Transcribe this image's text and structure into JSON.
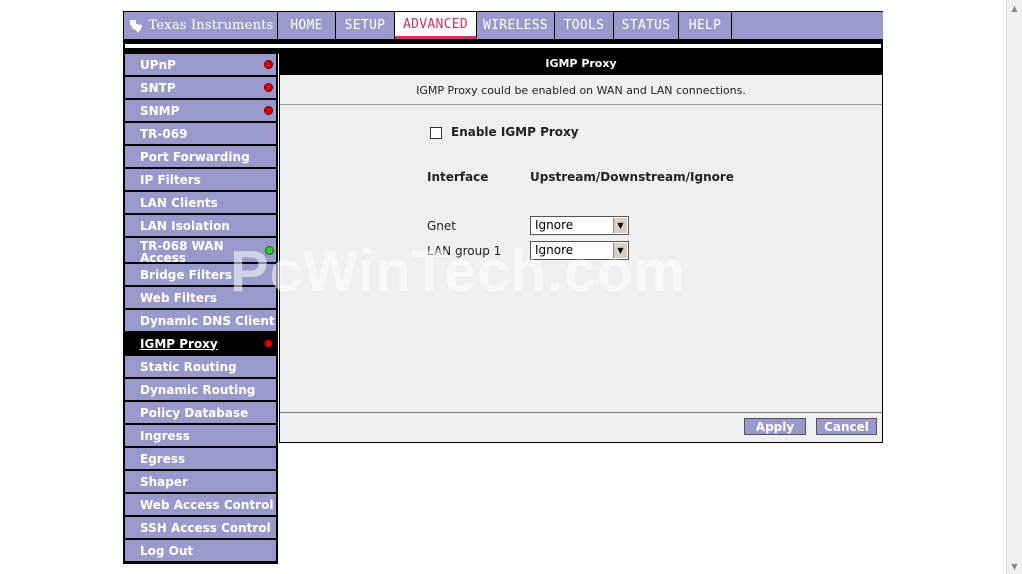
{
  "brand": {
    "name": "Texas Instruments"
  },
  "nav": {
    "tabs": [
      {
        "label": "HOME",
        "active": false
      },
      {
        "label": "SETUP",
        "active": false
      },
      {
        "label": "ADVANCED",
        "active": true
      },
      {
        "label": "WIRELESS",
        "active": false
      },
      {
        "label": "TOOLS",
        "active": false
      },
      {
        "label": "STATUS",
        "active": false
      },
      {
        "label": "HELP",
        "active": false
      }
    ]
  },
  "sidebar": {
    "items": [
      {
        "label": "UPnP",
        "status": "red"
      },
      {
        "label": "SNTP",
        "status": "red"
      },
      {
        "label": "SNMP",
        "status": "red"
      },
      {
        "label": "TR-069",
        "status": ""
      },
      {
        "label": "Port Forwarding",
        "status": ""
      },
      {
        "label": "IP Filters",
        "status": ""
      },
      {
        "label": "LAN Clients",
        "status": ""
      },
      {
        "label": "LAN Isolation",
        "status": ""
      },
      {
        "label": "TR-068 WAN Access",
        "status": "green"
      },
      {
        "label": "Bridge Filters",
        "status": ""
      },
      {
        "label": "Web Filters",
        "status": ""
      },
      {
        "label": "Dynamic DNS Client",
        "status": ""
      },
      {
        "label": "IGMP Proxy",
        "status": "red",
        "active": true
      },
      {
        "label": "Static Routing",
        "status": ""
      },
      {
        "label": "Dynamic Routing",
        "status": ""
      },
      {
        "label": "Policy Database",
        "status": ""
      },
      {
        "label": "Ingress",
        "status": ""
      },
      {
        "label": "Egress",
        "status": ""
      },
      {
        "label": "Shaper",
        "status": ""
      },
      {
        "label": "Web Access Control",
        "status": ""
      },
      {
        "label": "SSH Access Control",
        "status": ""
      },
      {
        "label": "Log Out",
        "status": ""
      }
    ]
  },
  "main": {
    "title": "IGMP Proxy",
    "description": "IGMP Proxy could be enabled on WAN and LAN connections.",
    "enable_label": "Enable IGMP Proxy",
    "enable_checked": false,
    "col_interface": "Interface",
    "col_mode": "Upstream/Downstream/Ignore",
    "rows": [
      {
        "interface": "Gnet",
        "mode": "Ignore"
      },
      {
        "interface": "LAN group 1",
        "mode": "Ignore"
      }
    ],
    "apply_label": "Apply",
    "cancel_label": "Cancel"
  },
  "watermark": "PcWinTech.com",
  "colors": {
    "accent": "#9999cc",
    "active_tab": "#cc3366",
    "header": "#000000"
  }
}
